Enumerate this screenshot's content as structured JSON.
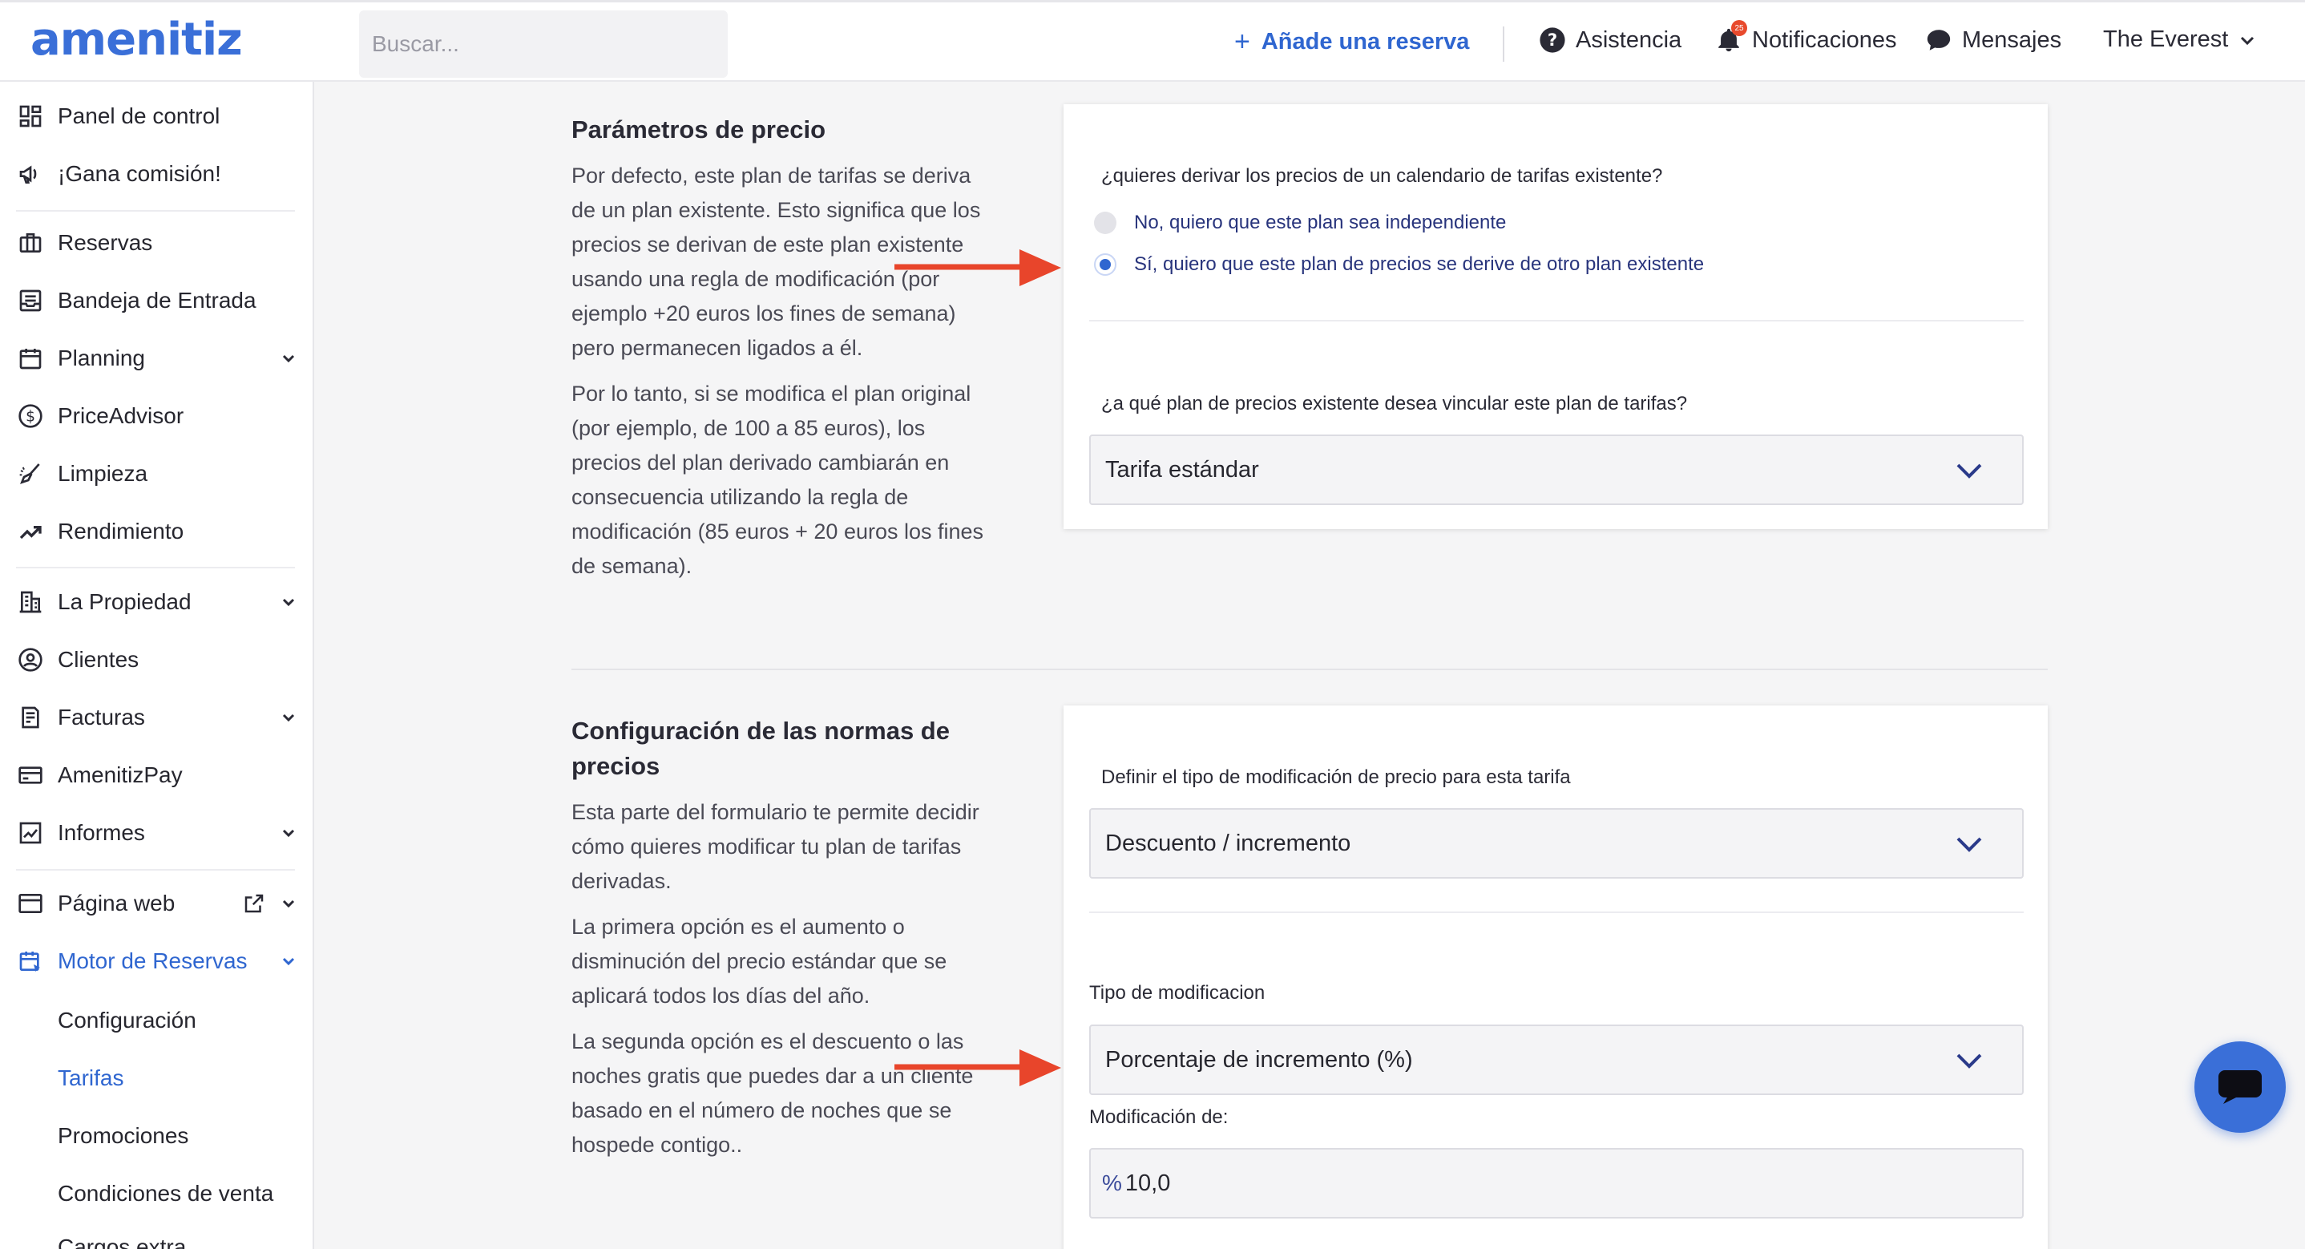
{
  "app": {
    "logo": "amenitiz"
  },
  "topbar": {
    "search_placeholder": "Buscar...",
    "add_reservation": "Añade una reserva",
    "help": "Asistencia",
    "notifications": "Notificaciones",
    "notifications_badge": "25",
    "messages": "Mensajes",
    "property": "The Everest"
  },
  "sidebar": {
    "items": [
      {
        "label": "Panel de control"
      },
      {
        "label": "¡Gana comisión!"
      },
      {
        "label": "Reservas"
      },
      {
        "label": "Bandeja de Entrada"
      },
      {
        "label": "Planning"
      },
      {
        "label": "PriceAdvisor"
      },
      {
        "label": "Limpieza"
      },
      {
        "label": "Rendimiento"
      },
      {
        "label": "La Propiedad"
      },
      {
        "label": "Clientes"
      },
      {
        "label": "Facturas"
      },
      {
        "label": "AmenitizPay"
      },
      {
        "label": "Informes"
      },
      {
        "label": "Página web"
      },
      {
        "label": "Motor de Reservas"
      }
    ],
    "subitems": [
      {
        "label": "Configuración"
      },
      {
        "label": "Tarifas"
      },
      {
        "label": "Promociones"
      },
      {
        "label": "Condiciones de venta"
      },
      {
        "label": "Cargos extra"
      }
    ]
  },
  "price_params": {
    "title": "Parámetros de precio",
    "desc_1": "Por defecto, este plan de tarifas se deriva de un plan existente. Esto significa que los precios se derivan de este plan existente usando una regla de modificación (por ejemplo +20 euros los fines de semana) pero permanecen ligados a él.",
    "desc_2": "Por lo tanto, si se modifica el plan original (por ejemplo, de 100 a 85 euros), los precios del plan derivado cambiarán en consecuencia utilizando la regla de modificación (85 euros + 20 euros los fines de semana).",
    "question_derive": "¿quieres derivar los precios de un calendario de tarifas existente?",
    "option_independent": "No, quiero que este plan sea independiente",
    "option_derived": "Sí, quiero que este plan de precios se derive de otro plan existente",
    "question_link": "¿a qué plan de precios existente desea vincular este plan de tarifas?",
    "linked_plan": "Tarifa estándar"
  },
  "rules_config": {
    "title": "Configuración de las normas de precios",
    "desc_1": "Esta parte del formulario te permite decidir cómo quieres modificar tu plan de tarifas derivadas.",
    "desc_2": "La primera opción es el aumento o disminución del precio estándar que se aplicará todos los días del año.",
    "desc_3": "La segunda opción es el descuento o las noches gratis que puedes dar a un cliente basado en el número de noches que se hospede contigo..",
    "mod_type_question": "Definir el tipo de modificación de precio para esta tarifa",
    "mod_type_value": "Descuento / incremento",
    "mod_kind_label": "Tipo de modificacion",
    "mod_kind_value": "Porcentaje de incremento (%)",
    "mod_amount_label": "Modificación de:",
    "mod_amount_prefix": "%",
    "mod_amount_value": "10,0"
  },
  "colors": {
    "accent": "#2f66d0",
    "arrow": "#e8452b",
    "brand": "#3a6fd8"
  }
}
